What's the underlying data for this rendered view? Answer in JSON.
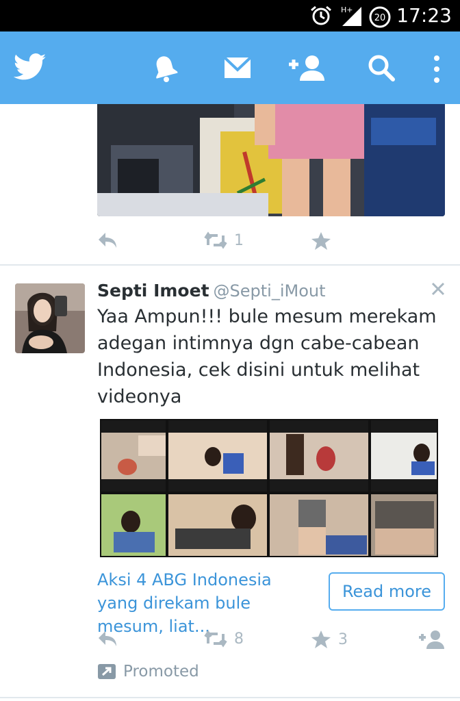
{
  "status_bar": {
    "time": "17:23",
    "network": "H+",
    "notification_count": "20",
    "icons": [
      "alarm-icon",
      "signal-icon",
      "notification-count-icon"
    ]
  },
  "app_bar": {
    "icons": [
      "twitter-logo-icon",
      "notifications-bell-icon",
      "messages-icon",
      "add-user-icon",
      "search-icon",
      "overflow-menu-icon"
    ],
    "background": "#55acee"
  },
  "previous_tweet": {
    "retweet_count": "1"
  },
  "promoted_tweet": {
    "name": "Septi Imoet",
    "handle": "@Septi_iMout",
    "text": "Yaa Ampun!!! bule mesum merekam adegan intimnya dgn cabe-cabean Indonesia, cek disini untuk melihat videonya",
    "card": {
      "title": "Aksi 4 ABG Indonesia yang direkam bule mesum, liat...",
      "button": "Read more"
    },
    "retweet_count": "8",
    "favorite_count": "3",
    "promoted_label": "Promoted"
  },
  "colors": {
    "accent": "#55acee",
    "link": "#3b94d9",
    "muted_icon": "#aab8c2",
    "divider": "#e1e8ed"
  }
}
